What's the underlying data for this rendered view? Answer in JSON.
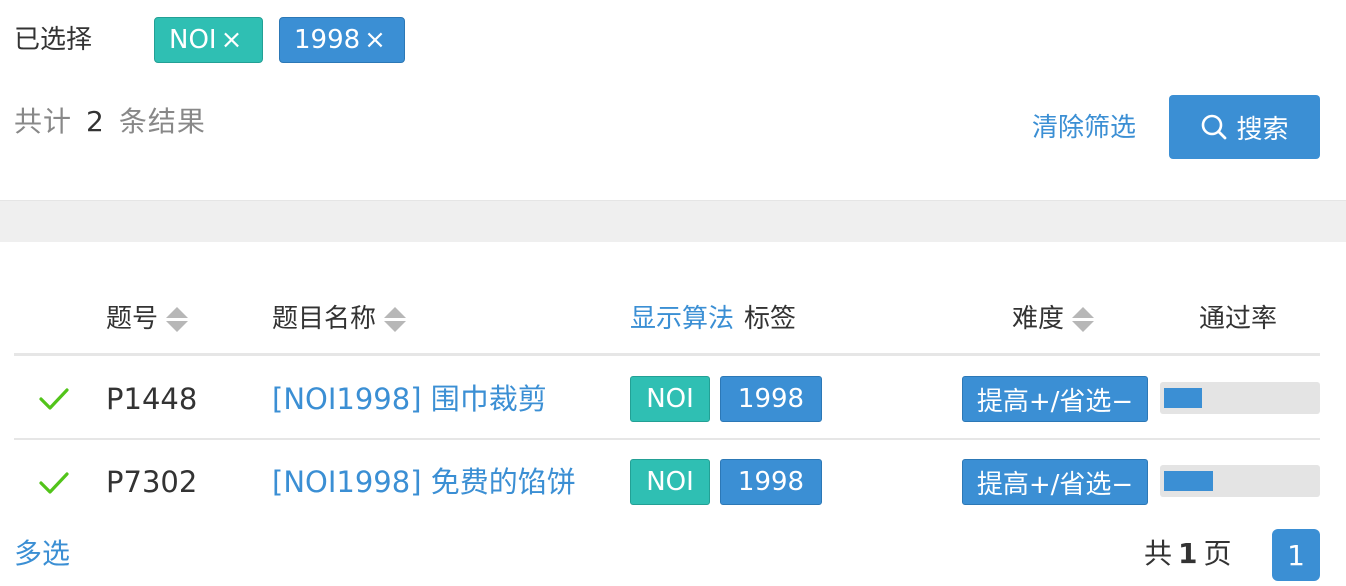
{
  "filters": {
    "selected_label": "已选择",
    "chips": [
      {
        "label": "NOI",
        "close": "×"
      },
      {
        "label": "1998",
        "close": "×"
      }
    ],
    "total_prefix": "共计",
    "total_count": "2",
    "total_suffix": "条结果",
    "clear_label": "清除筛选",
    "search_label": "搜索"
  },
  "table": {
    "headers": {
      "id": "题号",
      "title": "题目名称",
      "show_algo": "显示算法",
      "tags": "标签",
      "difficulty": "难度",
      "pass_rate": "通过率"
    },
    "rows": [
      {
        "status": "accepted",
        "id": "P1448",
        "title": "[NOI1998] 围巾裁剪",
        "tags": [
          "NOI",
          "1998"
        ],
        "difficulty": "提高+/省选−",
        "pass_rate": 0.25
      },
      {
        "status": "accepted",
        "id": "P7302",
        "title": "[NOI1998] 免费的馅饼",
        "tags": [
          "NOI",
          "1998"
        ],
        "difficulty": "提高+/省选−",
        "pass_rate": 0.32
      }
    ]
  },
  "footer": {
    "multi_select": "多选",
    "pages_prefix": "共",
    "pages_total": "1",
    "pages_suffix": "页",
    "current_page": "1"
  },
  "colors": {
    "accent": "#3b8fd4",
    "tag_teal": "#2fbfb3",
    "check_green": "#52c41a"
  }
}
